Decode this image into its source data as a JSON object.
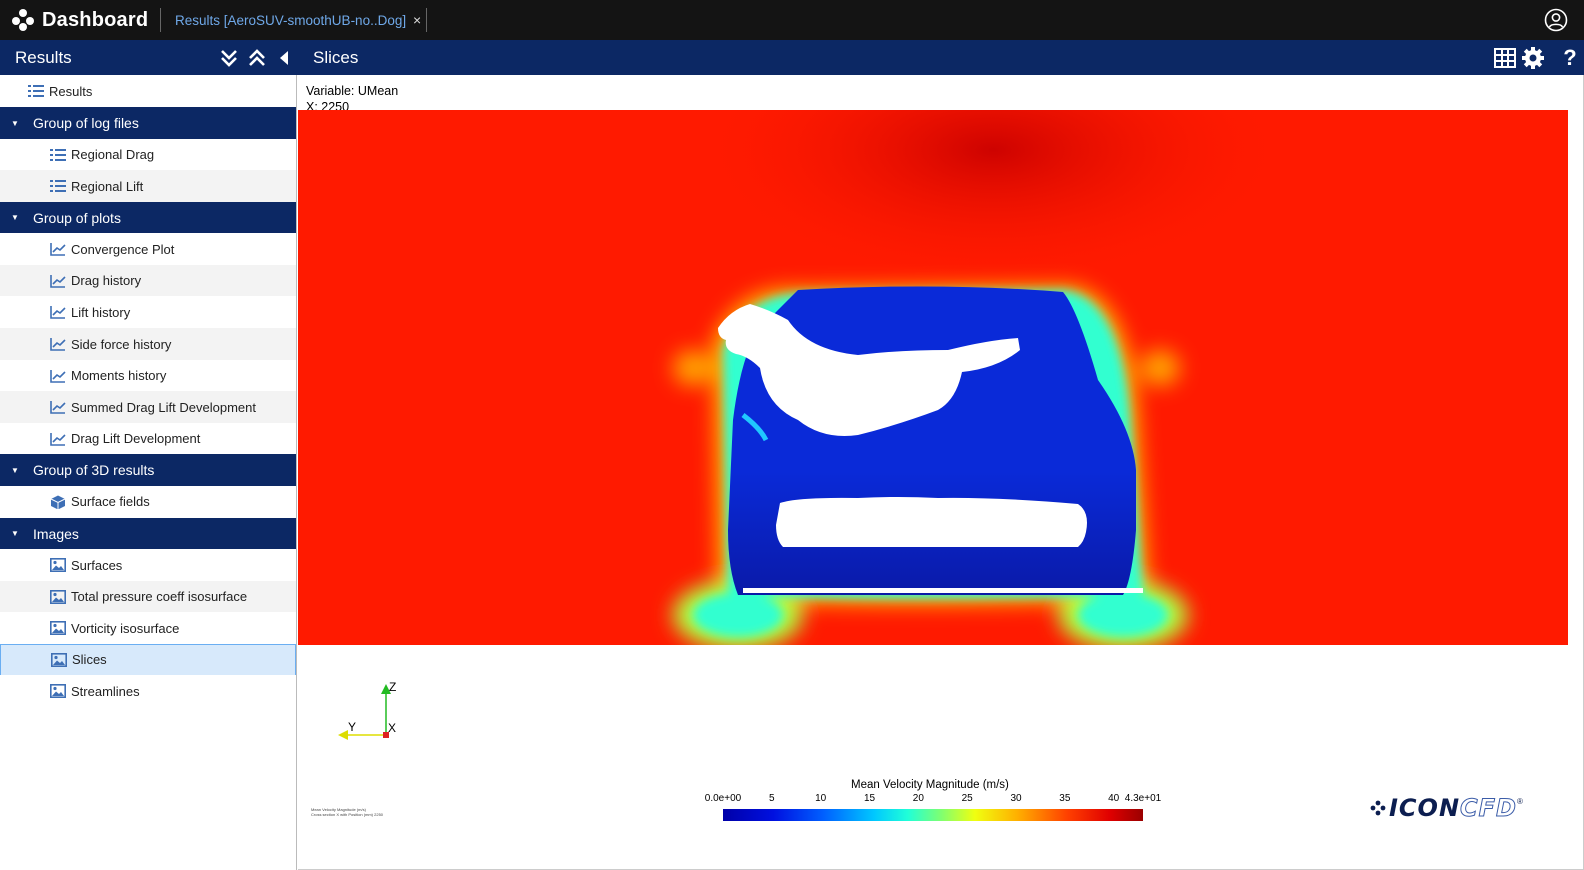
{
  "app": {
    "title": "Dashboard",
    "tab_label": "Results [AeroSUV-smoothUB-no..Dog]",
    "tab_close": "×"
  },
  "left_header": {
    "title": "Results"
  },
  "main_header": {
    "title": "Slices"
  },
  "sidebar": {
    "root": "Results",
    "items": [
      {
        "type": "group",
        "label": "Group of log files"
      },
      {
        "type": "item",
        "icon": "list-icon",
        "label": "Regional Drag"
      },
      {
        "type": "item",
        "icon": "list-icon",
        "label": "Regional Lift"
      },
      {
        "type": "group",
        "label": "Group of plots"
      },
      {
        "type": "item",
        "icon": "chart-icon",
        "label": "Convergence Plot"
      },
      {
        "type": "item",
        "icon": "chart-icon",
        "label": "Drag history"
      },
      {
        "type": "item",
        "icon": "chart-icon",
        "label": "Lift history"
      },
      {
        "type": "item",
        "icon": "chart-icon",
        "label": "Side force history"
      },
      {
        "type": "item",
        "icon": "chart-icon",
        "label": "Moments history"
      },
      {
        "type": "item",
        "icon": "chart-icon",
        "label": "Summed Drag Lift Development"
      },
      {
        "type": "item",
        "icon": "chart-icon",
        "label": "Drag Lift Development"
      },
      {
        "type": "group",
        "label": "Group of 3D results"
      },
      {
        "type": "item",
        "icon": "cube-icon",
        "label": "Surface fields"
      },
      {
        "type": "group",
        "label": "Images"
      },
      {
        "type": "item",
        "icon": "image-icon",
        "label": "Surfaces"
      },
      {
        "type": "item",
        "icon": "image-icon",
        "label": "Total pressure coeff isosurface"
      },
      {
        "type": "item",
        "icon": "image-icon",
        "label": "Vorticity isosurface"
      },
      {
        "type": "item",
        "icon": "image-icon",
        "label": "Slices",
        "selected": true
      },
      {
        "type": "item",
        "icon": "image-icon",
        "label": "Streamlines"
      }
    ]
  },
  "viewer": {
    "variable": "Variable: UMean",
    "position": "X: 2250",
    "axes": {
      "z": "Z",
      "y": "Y",
      "x": "X"
    },
    "note_line1": "Mean Velocity Magnitude (m/s)",
    "note_line2": "Cross section X with Position (mm) 2250",
    "colorbar": {
      "title": "Mean Velocity Magnitude (m/s)",
      "min_label": "0.0e+00",
      "max_label": "4.3e+01",
      "ticks": [
        "5",
        "10",
        "15",
        "20",
        "25",
        "30",
        "35",
        "40"
      ],
      "min": 0,
      "max": 43
    },
    "logo_a": "ICON",
    "logo_b": "CFD",
    "logo_mark": "®"
  },
  "colors": {
    "topbar": "#141414",
    "header": "#0c2864",
    "accent_tab": "#6fa8e8",
    "selected_bg": "#d7e9fb",
    "field_red": "#ff1a00",
    "body_blue": "#0a2ad8"
  }
}
